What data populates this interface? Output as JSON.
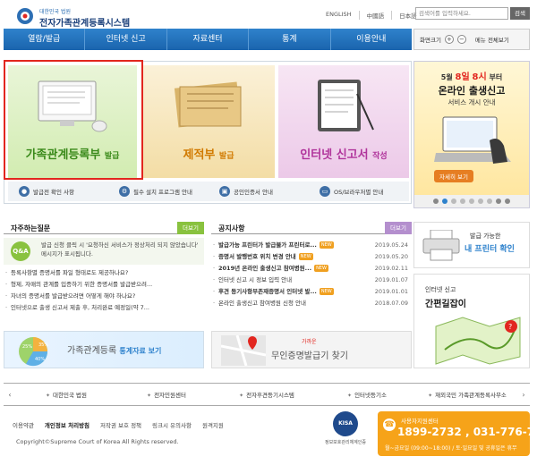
{
  "header": {
    "logo_sub": "대한민국 법원",
    "logo_main": "전자가족관계등록시스템",
    "langs": [
      "ENGLISH",
      "中國語",
      "日本語"
    ],
    "search_placeholder": "검색어를 입력하세요.",
    "search_button": "검색"
  },
  "nav": {
    "items": [
      "열람/발급",
      "인터넷 신고",
      "자료센터",
      "통계",
      "이용안내"
    ]
  },
  "tools": {
    "zoom_label": "화면크기",
    "zoom_in": "+",
    "zoom_out": "−",
    "menu_all": "메뉴 전체보기"
  },
  "banner": {
    "panels": [
      {
        "title": "가족관계등록부",
        "suffix": "발급"
      },
      {
        "title": "제적부",
        "suffix": "발급"
      },
      {
        "title": "인터넷 신고서",
        "suffix": "작성"
      }
    ],
    "quick": [
      "발급전 확인 사항",
      "필수 설치 프로그램 안내",
      "공인인증서 안내",
      "OS/브라우저별 안내"
    ]
  },
  "promo": {
    "date_a": "5월",
    "date_b": "8일",
    "date_c": "8시",
    "date_d": "부터",
    "main": "온라인 출생신고",
    "sub": "서비스 개시 안내",
    "button": "자세히 보기"
  },
  "faq": {
    "title": "자주하는질문",
    "more": "더보기",
    "badge": "Q&A",
    "intro": "발급 신청 클릭 시 '요청하신 서비스가 정상처리 되지 않았습니다' 메시지가 표시됩니다.",
    "items": [
      "등록사항별 증명서를 파일 형태로도 제공하나요?",
      "형제, 자매의 관계를 입증하기 위한 증명서를 발급받으려...",
      "자녀의 증명서를 발급받으려면 어떻게 해야 하나요?",
      "인터넷으로 출생 신고서 제출 후, 처리완료 예정일(약 7..."
    ]
  },
  "notice": {
    "title": "공지사항",
    "more": "더보기",
    "new_label": "NEW",
    "items": [
      {
        "text": "발급가능 프린터가 발급불가 프린터로...",
        "date": "2019.05.24",
        "new": true
      },
      {
        "text": "증명서 발행번호 위치 변경 안내",
        "date": "2019.05.20",
        "new": true
      },
      {
        "text": "2019년 온라인 출생신고 참여병원...",
        "date": "2019.02.11",
        "new": true
      },
      {
        "text": "인터넷 신고 시 정보 입력 안내",
        "date": "2019.01.07",
        "new": false
      },
      {
        "text": "후견 등기사항부존재증명서 인터넷 발...",
        "date": "2019.01.01",
        "new": true
      },
      {
        "text": "온라인 출생신고 참여병원 신청 안내",
        "date": "2018.07.09",
        "new": false
      }
    ]
  },
  "stat_banner": {
    "text": "가족관계등록",
    "link": "통계자료 보기",
    "pct": [
      "25%",
      "35%",
      "40%"
    ]
  },
  "map_banner": {
    "t1": "가까운",
    "t2": "무인증명발급기 찾기"
  },
  "printer": {
    "a": "발급 가능한",
    "b": "내 프린터 확인"
  },
  "simple": {
    "a": "인터넷 신고",
    "b": "간편길잡이"
  },
  "footer_links": [
    "대한민국 법원",
    "전자민원센터",
    "전자후견등기시스템",
    "인터넷등기소",
    "재외국민 가족관계등록사무소"
  ],
  "bottom_links": [
    {
      "label": "이용약관",
      "bold": false
    },
    {
      "label": "개인정보 처리방침",
      "bold": true
    },
    {
      "label": "저작권 보호 정책",
      "bold": false
    },
    {
      "label": "링크시 유의사항",
      "bold": false
    },
    {
      "label": "원격지원",
      "bold": false
    }
  ],
  "copyright": "Copyright©Supreme Court of Korea All Rights reserved.",
  "kisa": {
    "logo": "KISA",
    "caption": "정보보호관리체계인증"
  },
  "callbox": {
    "label": "사용자지원센터",
    "phone": "1899-2732 , 031-776-7878",
    "hours": "월~금요일 (09:00~18:00) / 토·일요일 및 공휴일은 휴무"
  }
}
